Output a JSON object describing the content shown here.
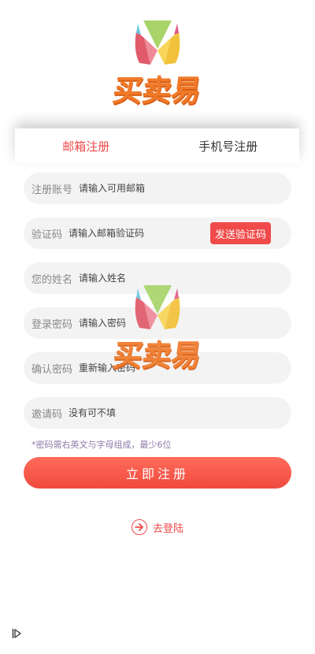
{
  "brand": {
    "name": "买卖易"
  },
  "tabs": [
    {
      "label": "邮箱注册",
      "active": true
    },
    {
      "label": "手机号注册",
      "active": false
    }
  ],
  "form": {
    "account": {
      "label": "注册账号",
      "placeholder": "请输入可用邮箱"
    },
    "code": {
      "label": "验证码",
      "placeholder": "请输入邮箱验证码",
      "button": "发送验证码"
    },
    "name": {
      "label": "您的姓名",
      "placeholder": "请输入姓名"
    },
    "password": {
      "label": "登录密码",
      "placeholder": "请输入密码"
    },
    "confirm": {
      "label": "确认密码",
      "placeholder": "重新输入密码"
    },
    "invite": {
      "label": "邀请码",
      "placeholder": "没有可不填"
    },
    "hint": "*密码需右英文与字母组成，最少6位",
    "submit": "立即注册"
  },
  "login_link": {
    "label": "去登陆"
  },
  "colors": {
    "accent": "#f04a4a",
    "brand_orange": "#f07a2a",
    "field_bg": "#f3f3f3"
  },
  "icons": {
    "login": "arrow-right-circle-icon",
    "corner": "play-triangle-icon"
  }
}
